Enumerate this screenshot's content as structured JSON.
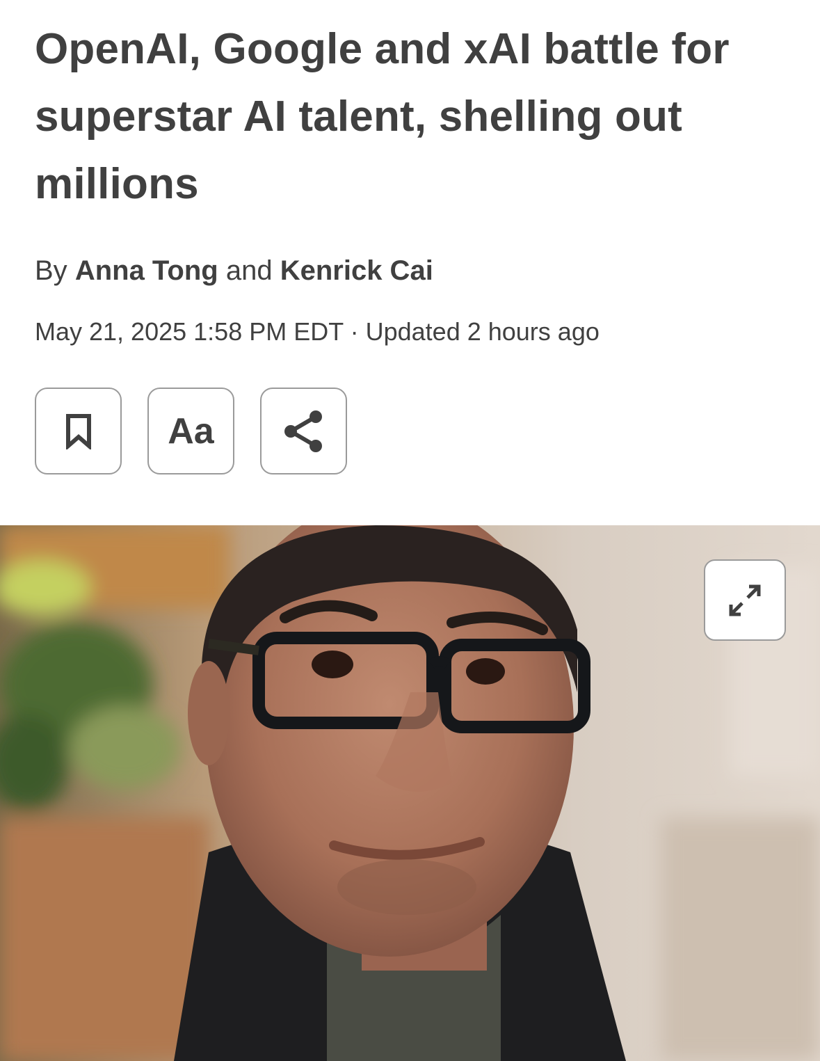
{
  "article": {
    "headline_lines": [
      "OpenAI, Google and xAI battle for",
      "superstar AI talent, shelling out",
      "millions"
    ],
    "byline": {
      "prefix": "By",
      "authors": [
        "Anna Tong",
        "Kenrick Cai"
      ],
      "conjunction": "and"
    },
    "dateline": {
      "published": "May 21, 2025 1:58 PM EDT",
      "separator": "·",
      "updated": "Updated 2 hours ago"
    }
  },
  "actions": {
    "bookmark_icon": "bookmark-icon",
    "text_size_label": "Aa",
    "share_icon": "share-icon"
  },
  "hero_image": {
    "expand_icon": "expand-icon"
  },
  "colors": {
    "text": "#404040",
    "button_border": "#9a9a9a",
    "background": "#ffffff"
  }
}
